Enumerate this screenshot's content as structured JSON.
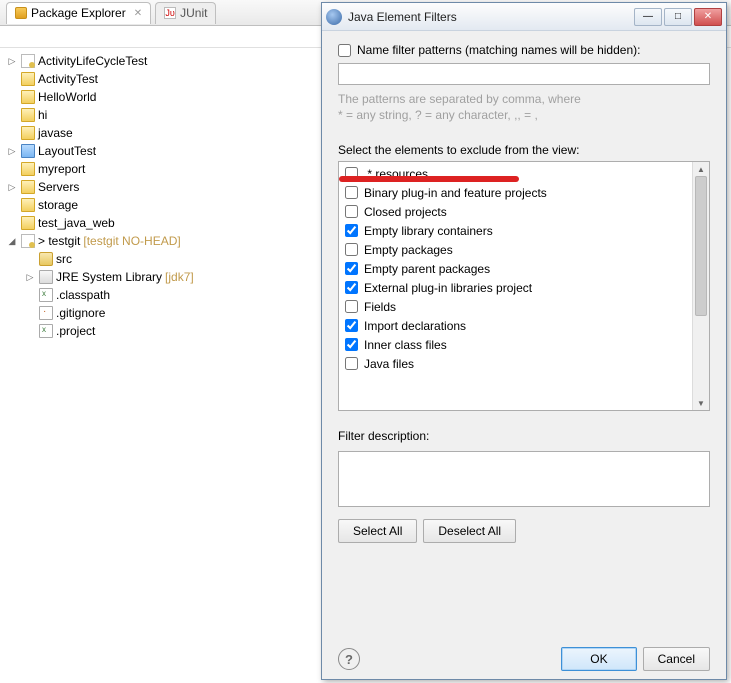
{
  "tabs": {
    "package_explorer": "Package Explorer",
    "junit": "JUnit"
  },
  "tree": {
    "items": [
      {
        "label": "ActivityLifeCycleTest",
        "icon": "proj",
        "expand": "▷",
        "depth": 0
      },
      {
        "label": "ActivityTest",
        "icon": "folder",
        "expand": "",
        "depth": 0
      },
      {
        "label": "HelloWorld",
        "icon": "folder",
        "expand": "",
        "depth": 0
      },
      {
        "label": "hi",
        "icon": "folder",
        "expand": "",
        "depth": 0
      },
      {
        "label": "javase",
        "icon": "folder",
        "expand": "",
        "depth": 0
      },
      {
        "label": "LayoutTest",
        "icon": "layout",
        "expand": "▷",
        "depth": 0
      },
      {
        "label": "myreport",
        "icon": "folder",
        "expand": "",
        "depth": 0
      },
      {
        "label": "Servers",
        "icon": "folder",
        "expand": "▷",
        "depth": 0
      },
      {
        "label": "storage",
        "icon": "folder",
        "expand": "",
        "depth": 0
      },
      {
        "label": "test_java_web",
        "icon": "folder",
        "expand": "",
        "depth": 0
      },
      {
        "label": "> testgit",
        "decor": "[testgit NO-HEAD]",
        "icon": "proj",
        "expand": "◢",
        "depth": 0
      },
      {
        "label": "src",
        "icon": "pkg",
        "expand": "",
        "depth": 1
      },
      {
        "label": "JRE System Library",
        "decor": "[jdk7]",
        "icon": "lib",
        "expand": "▷",
        "depth": 1
      },
      {
        "label": ".classpath",
        "icon": "file-x",
        "expand": "",
        "depth": 1
      },
      {
        "label": ".gitignore",
        "icon": "file-g",
        "expand": "",
        "depth": 1
      },
      {
        "label": ".project",
        "icon": "file-x",
        "expand": "",
        "depth": 1
      }
    ]
  },
  "dialog": {
    "title": "Java Element Filters",
    "name_filter_label": "Name filter patterns (matching names will be hidden):",
    "hint_line1": "The patterns are separated by comma, where",
    "hint_line2": "* = any string, ? = any character, ,, = ,",
    "select_label": "Select the elements to exclude from the view:",
    "items": [
      {
        "label": ".* resources",
        "checked": false
      },
      {
        "label": "Binary plug-in and feature projects",
        "checked": false
      },
      {
        "label": "Closed projects",
        "checked": false
      },
      {
        "label": "Empty library containers",
        "checked": true
      },
      {
        "label": "Empty packages",
        "checked": false
      },
      {
        "label": "Empty parent packages",
        "checked": true
      },
      {
        "label": "External plug-in libraries project",
        "checked": true
      },
      {
        "label": "Fields",
        "checked": false
      },
      {
        "label": "Import declarations",
        "checked": true
      },
      {
        "label": "Inner class files",
        "checked": true
      },
      {
        "label": "Java files",
        "checked": false
      }
    ],
    "desc_label": "Filter description:",
    "select_all": "Select All",
    "deselect_all": "Deselect All",
    "ok": "OK",
    "cancel": "Cancel"
  }
}
